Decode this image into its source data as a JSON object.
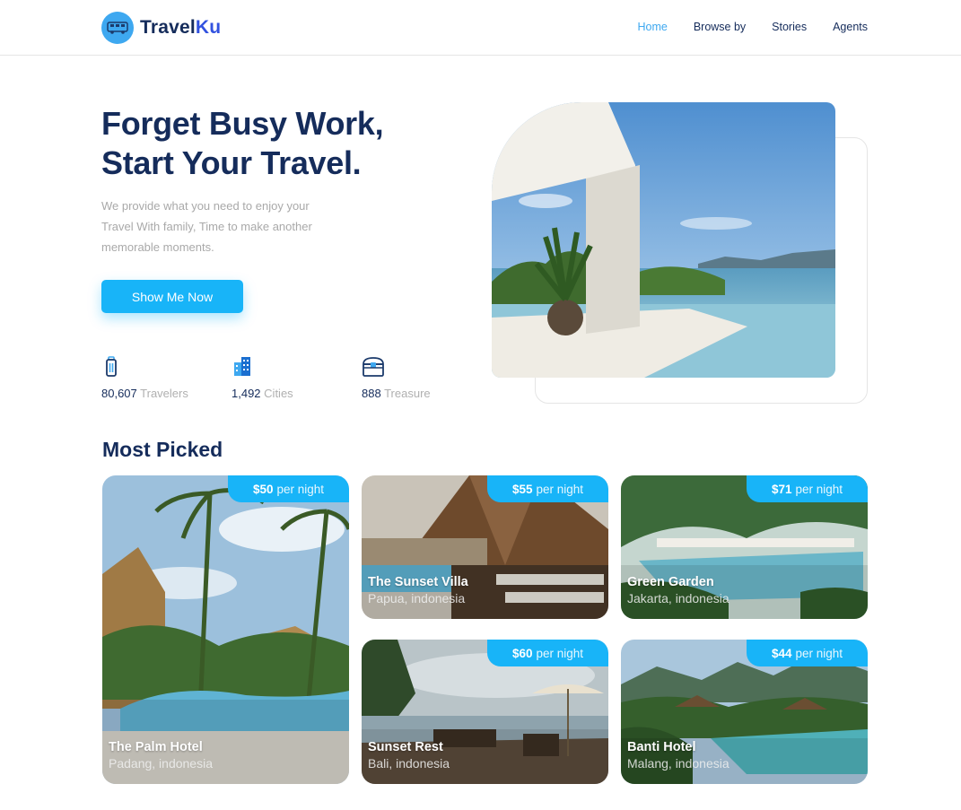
{
  "brand": {
    "name_part1": "Travel",
    "name_part2": "Ku"
  },
  "nav": {
    "items": [
      {
        "label": "Home",
        "active": true
      },
      {
        "label": "Browse by",
        "active": false
      },
      {
        "label": "Stories",
        "active": false
      },
      {
        "label": "Agents",
        "active": false
      }
    ]
  },
  "hero": {
    "title_line1": "Forget Busy Work,",
    "title_line2": "Start Your Travel.",
    "subtitle": "We provide what you need to enjoy your Travel With family, Time to make another memorable moments.",
    "cta_label": "Show Me Now",
    "stats": [
      {
        "value": "80,607",
        "label": "Travelers",
        "icon": "suitcase-icon"
      },
      {
        "value": "1,492",
        "label": "Cities",
        "icon": "building-icon"
      },
      {
        "value": "888",
        "label": "Treasure",
        "icon": "treasure-icon"
      }
    ]
  },
  "most_picked": {
    "title": "Most Picked",
    "cards": [
      {
        "price": "$50",
        "unit": "per night",
        "name": "The Palm Hotel",
        "location": "Padang, indonesia"
      },
      {
        "price": "$55",
        "unit": "per night",
        "name": "The Sunset Villa",
        "location": "Papua, indonesia"
      },
      {
        "price": "$71",
        "unit": "per night",
        "name": "Green Garden",
        "location": "Jakarta, indonesia"
      },
      {
        "price": "$60",
        "unit": "per night",
        "name": "Sunset Rest",
        "location": "Bali, indonesia"
      },
      {
        "price": "$44",
        "unit": "per night",
        "name": "Banti Hotel",
        "location": "Malang, indonesia"
      }
    ]
  },
  "colors": {
    "primary": "#18b4f8",
    "navy": "#152c5b",
    "brand_blue": "#3252df",
    "muted": "#b0b0b0"
  }
}
